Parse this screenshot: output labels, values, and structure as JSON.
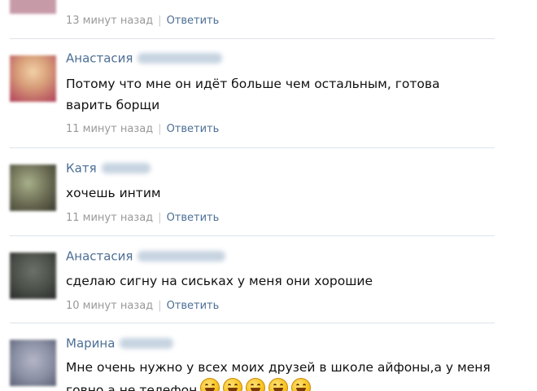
{
  "comments": [
    {
      "author": "",
      "text": "",
      "time": "13 минут назад",
      "reply_label": "Ответить",
      "avatar_color": "#c79aa8"
    },
    {
      "author": "Анастасия",
      "text": "Потому что мне он идёт больше чем остальным, готова варить борщи",
      "time": "11 минут назад",
      "reply_label": "Ответить",
      "avatar_color": "#d8a07a"
    },
    {
      "author": "Катя",
      "text": "хочешь интим",
      "time": "11 минут назад",
      "reply_label": "Ответить",
      "avatar_color": "#6a6a52"
    },
    {
      "author": "Анастасия",
      "text": "сделаю сигну на сиськах у меня они хорошие",
      "time": "10 минут назад",
      "reply_label": "Ответить",
      "avatar_color": "#4a4f48"
    },
    {
      "author": "Марина",
      "text": "Мне очень нужно у всех моих друзей в школе айфоны,а у меня говно а не телефон",
      "time": "",
      "reply_label": "",
      "avatar_color": "#8a8fa3",
      "emoji_icons": [
        "grinning-face-icon",
        "grinning-face-icon",
        "grinning-face-icon",
        "grinning-face-icon",
        "grinning-face-icon"
      ]
    }
  ],
  "colors": {
    "author_link": "#4d6f96",
    "reply_link": "#4d6f96",
    "time_text": "#999999",
    "divider": "#dde3ea"
  }
}
